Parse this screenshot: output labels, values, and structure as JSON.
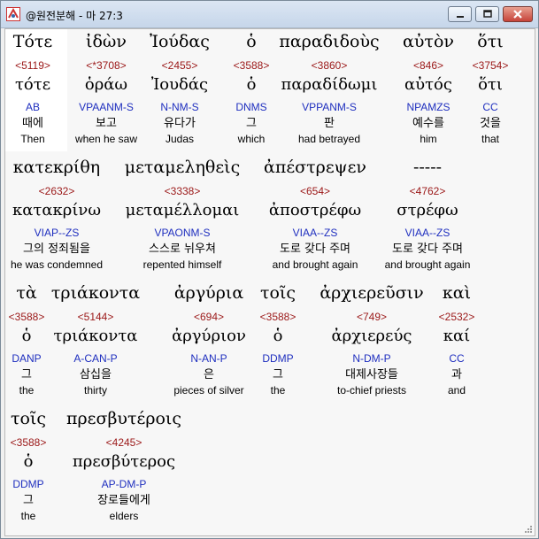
{
  "window": {
    "title": "@원전분해 - 마 27:3"
  },
  "rows": [
    {
      "words": [
        {
          "greek": "Τότε",
          "strong": "<5119>",
          "lemma": "τότε",
          "morph": "AB",
          "korean": "때에",
          "english": "Then"
        },
        {
          "greek": "ἰδὼν",
          "strong": "<*3708>",
          "lemma": "ὁράω",
          "morph": "VPAANM-S",
          "korean": "보고",
          "english": "when he saw"
        },
        {
          "greek": "Ἰούδας",
          "strong": "<2455>",
          "lemma": "Ἰουδάς",
          "morph": "N-NM-S",
          "korean": "유다가",
          "english": "Judas"
        },
        {
          "greek": "ὁ",
          "strong": "<3588>",
          "lemma": "ὁ",
          "morph": "DNMS",
          "korean": "그",
          "english": "which"
        },
        {
          "greek": "παραδιδοὺς",
          "strong": "<3860>",
          "lemma": "παραδίδωμι",
          "morph": "VPPANM-S",
          "korean": "판",
          "english": "had betrayed"
        },
        {
          "greek": "αὐτὸν",
          "strong": "<846>",
          "lemma": "αὐτός",
          "morph": "NPAMZS",
          "korean": "예수를",
          "english": "him"
        },
        {
          "greek": "ὅτι",
          "strong": "<3754>",
          "lemma": "ὅτι",
          "morph": "CC",
          "korean": "것을",
          "english": "that"
        }
      ]
    },
    {
      "words": [
        {
          "greek": "κατεκρίθη",
          "strong": "<2632>",
          "lemma": "κατακρίνω",
          "morph": "VIAP--ZS",
          "korean": "그의 정죄됨을",
          "english": "he was condemned"
        },
        {
          "greek": "μεταμεληθεὶς",
          "strong": "<3338>",
          "lemma": "μεταμέλλομαι",
          "morph": "VPAONM-S",
          "korean": "스스로 뉘우쳐",
          "english": "repented himself"
        },
        {
          "greek": "ἀπέστρεψεν",
          "strong": "<654>",
          "lemma": "ἀποστρέφω",
          "morph": "VIAA--ZS",
          "korean": "도로 갖다 주며",
          "english": "and brought again"
        },
        {
          "greek": "-----",
          "strong": "<4762>",
          "lemma": "στρέφω",
          "morph": "VIAA--ZS",
          "korean": "도로 갖다 주며",
          "english": "and brought again"
        }
      ]
    },
    {
      "words": [
        {
          "greek": "τὰ",
          "strong": "<3588>",
          "lemma": "ὁ",
          "morph": "DANP",
          "korean": "그",
          "english": "the"
        },
        {
          "greek": "τριάκοντα",
          "strong": "<5144>",
          "lemma": "τριάκοντα",
          "morph": "A-CAN-P",
          "korean": "삼십을",
          "english": "thirty"
        },
        {
          "greek": "ἀργύρια",
          "strong": "<694>",
          "lemma": "ἀργύριον",
          "morph": "N-AN-P",
          "korean": "은",
          "english": "pieces of silver"
        },
        {
          "greek": "τοῖς",
          "strong": "<3588>",
          "lemma": "ὁ",
          "morph": "DDMP",
          "korean": "그",
          "english": "the"
        },
        {
          "greek": "ἀρχιερεῦσιν",
          "strong": "<749>",
          "lemma": "ἀρχιερεύς",
          "morph": "N-DM-P",
          "korean": "대제사장들",
          "english": "to-chief priests"
        },
        {
          "greek": "καὶ",
          "strong": "<2532>",
          "lemma": "καί",
          "morph": "CC",
          "korean": "과",
          "english": "and"
        }
      ]
    },
    {
      "words": [
        {
          "greek": "τοῖς",
          "strong": "<3588>",
          "lemma": "ὁ",
          "morph": "DDMP",
          "korean": "그",
          "english": "the"
        },
        {
          "greek": "πρεσβυτέροις",
          "strong": "<4245>",
          "lemma": "πρεσβύτερος",
          "morph": "AP-DM-P",
          "korean": "장로들에게",
          "english": "elders"
        }
      ]
    }
  ]
}
